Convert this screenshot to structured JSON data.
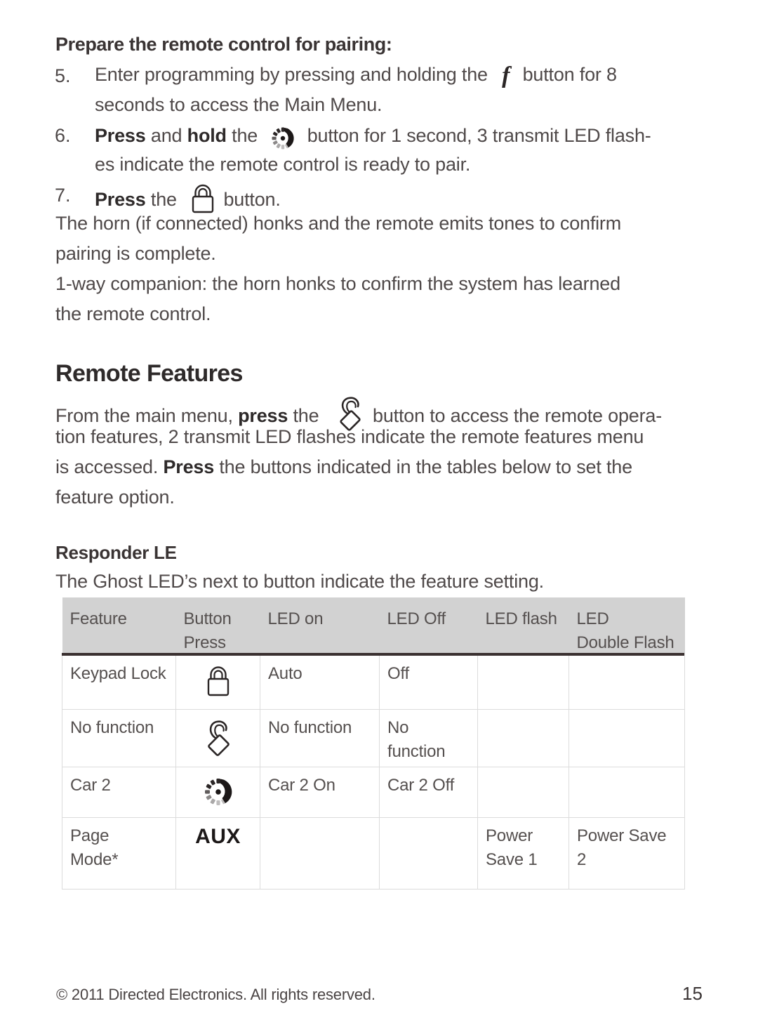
{
  "page": {
    "number": "15",
    "copyright": "© 2011 Directed Electronics. All rights reserved."
  },
  "section_pairing": {
    "heading": "Prepare the remote control for pairing:",
    "steps": [
      {
        "number": "5.",
        "line1_a": "Enter programming by pressing and holding the",
        "icon": "f-button-icon",
        "icon_label": "f",
        "line1_b": "button for 8",
        "line2": "seconds to access the Main Menu."
      },
      {
        "number": "6.",
        "line1_a": "Press",
        "line1_b": "and",
        "line1_c": "hold",
        "line1_d": "the",
        "icon": "remote-start-icon",
        "line1_e": "button for 1 second, 3 transmit LED flash-",
        "line2": "es indicate the remote control is ready to pair."
      },
      {
        "number": "7.",
        "line1_a": "Press",
        "line1_b": "the",
        "icon": "lock-icon",
        "line1_c": "button."
      }
    ],
    "paragraphs": [
      "The horn (if connected) honks and the remote emits tones to confirm",
      "pairing is complete.",
      "1-way companion: the horn honks to confirm the system has learned",
      "the remote control."
    ]
  },
  "section_remote_features": {
    "heading": "Remote Features",
    "line1_a": "From the main menu,",
    "line1_b": "press",
    "line1_c": "the",
    "line1_icon": "unlock-icon",
    "line1_d": "button to access the remote opera-",
    "line2": "tion features, 2 transmit LED flashes indicate the remote features menu",
    "line3_a": "is accessed.",
    "line3_b": "Press",
    "line3_c": "the buttons indicated in the tables below to set the",
    "line4": "feature option."
  },
  "section_responder": {
    "heading": "Responder LE",
    "intro": "The Ghost LED’s next to button indicate the feature setting."
  },
  "table": {
    "headers": [
      "Feature",
      "Button\nPress",
      "LED on",
      "LED Off",
      "LED flash",
      "LED\nDouble Flash"
    ],
    "headers_line1": [
      "Feature",
      "Button",
      "LED on",
      "LED Off",
      "LED flash",
      "LED"
    ],
    "headers_line2": [
      "",
      "Press",
      "",
      "",
      "",
      "Double Flash"
    ],
    "rows": [
      {
        "feature": "Keypad Lock",
        "button_icon": "lock-icon",
        "button_text": "",
        "led_on": "Auto",
        "led_off": "Off",
        "led_flash": "",
        "led_double_flash": ""
      },
      {
        "feature": "No function",
        "button_icon": "unlock-icon",
        "button_text": "",
        "led_on": "No function",
        "led_off": "No function",
        "led_flash": "",
        "led_double_flash": ""
      },
      {
        "feature": "Car 2",
        "button_icon": "remote-start-icon",
        "button_text": "",
        "led_on": "Car 2 On",
        "led_off": "Car 2 Off",
        "led_flash": "",
        "led_double_flash": ""
      },
      {
        "feature": "Page Mode*",
        "feature_line1": "Page",
        "feature_line2": "Mode*",
        "button_icon": "aux-text",
        "button_text": "AUX",
        "led_on": "",
        "led_off": "",
        "led_flash": "Power Save 1",
        "led_double_flash": "Power Save 2"
      }
    ]
  },
  "colors": {
    "header_bg": "#d2d2d2",
    "header_rule": "#3a3030",
    "grid": "#dcdcdc",
    "text": "#4f4949"
  }
}
